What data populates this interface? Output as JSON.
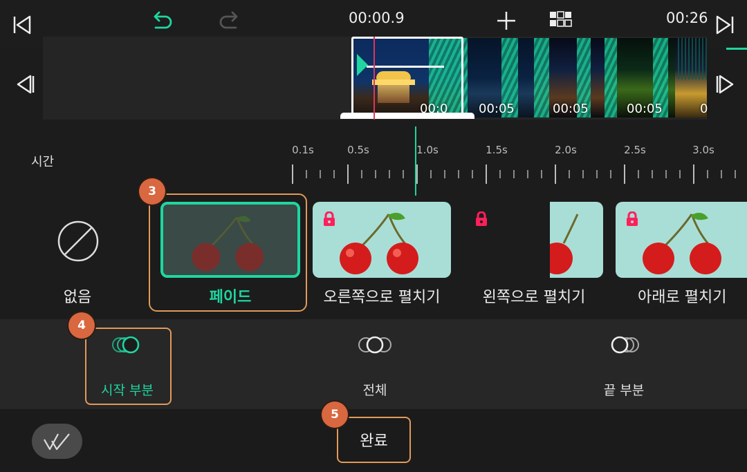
{
  "topbar": {
    "current_time": "00:00.9",
    "total_time": "00:26"
  },
  "clips": [
    {
      "duration": "00:0"
    },
    {
      "duration": "00:05"
    },
    {
      "duration": "00:05"
    },
    {
      "duration": "00:05"
    },
    {
      "duration": "0"
    }
  ],
  "ruler": {
    "section_label": "시간",
    "ticks": [
      "0.1s",
      "0.5s",
      "1.0s",
      "1.5s",
      "2.0s",
      "2.5s",
      "3.0s"
    ]
  },
  "transitions": [
    {
      "label": "없음"
    },
    {
      "label": "페이드"
    },
    {
      "label": "오른쪽으로 펼치기"
    },
    {
      "label": "왼쪽으로 펼치기"
    },
    {
      "label": "아래로 펼치기"
    }
  ],
  "modes": [
    {
      "label": "시작 부분"
    },
    {
      "label": "전체"
    },
    {
      "label": "끝 부분"
    }
  ],
  "bottom": {
    "done_label": "완료"
  },
  "badges": {
    "b3": "3",
    "b4": "4",
    "b5": "5"
  },
  "colors": {
    "accent": "#1fd6a0",
    "callout": "#e39a5a",
    "badge": "#d9673f",
    "lock": "#ff1f5a",
    "playhead": "#e0355a"
  }
}
